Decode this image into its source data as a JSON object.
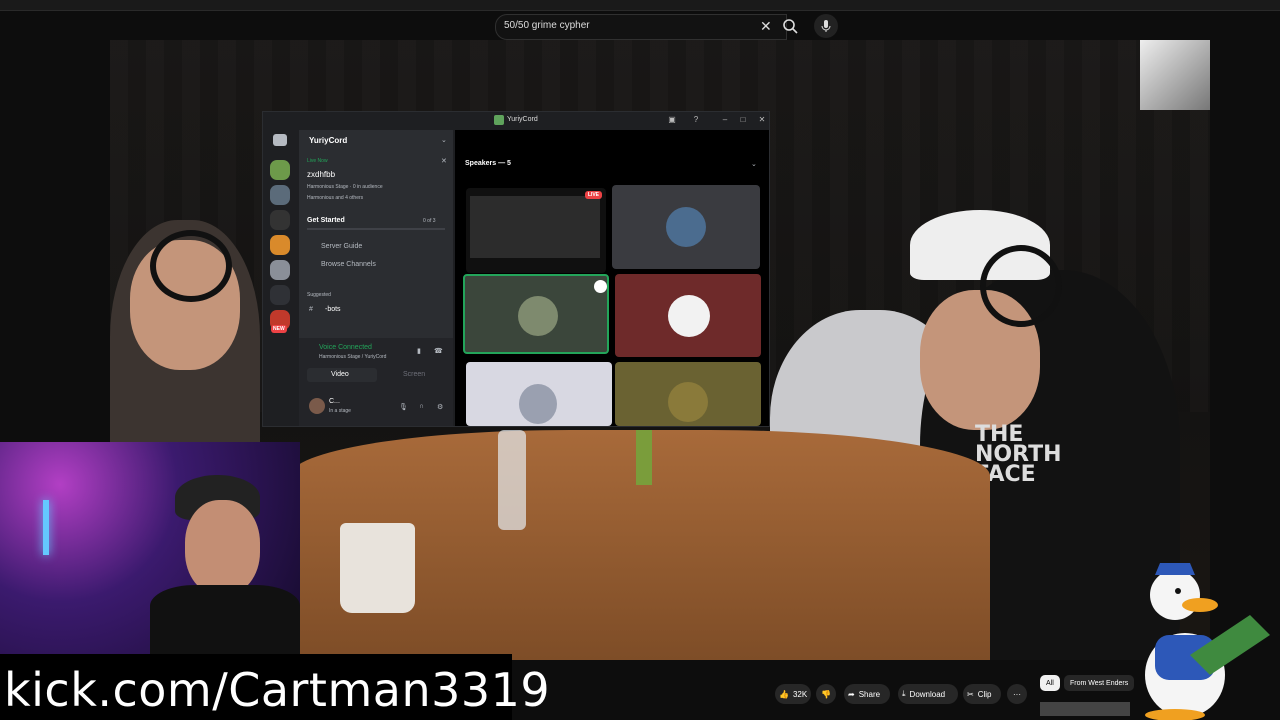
{
  "search": {
    "value": "50/50 grime cypher"
  },
  "discord": {
    "window_title": "YuriyCord",
    "server_name": "YuriyCord",
    "live_now": "Live Now",
    "stage_name": "zxdhfbb",
    "stage_sub": "Harmonious Stage · 0 in audience",
    "stage_people": "Harmonious and 4 others",
    "get_started": "Get Started",
    "get_started_progress": "0 of 3",
    "channels": [
      "Server Guide",
      "Browse Channels"
    ],
    "suggested": "Suggested",
    "bots_channel": "-bots",
    "new_badge": "NEW",
    "voice_connected": "Voice Connected",
    "voice_location": "Harmonious Stage / YuriyCord",
    "video_button": "Video",
    "screen_button": "Screen",
    "user_name": "C...",
    "user_status": "In a stage",
    "speakers_header": "Speakers — 5",
    "live_badge": "LIVE"
  },
  "overlay": {
    "kick_url": "kick.com/Cartman3319"
  },
  "actions": {
    "like_count": "32K",
    "share": "Share",
    "download": "Download",
    "clip": "Clip",
    "more": "···"
  },
  "chips": {
    "all": "All",
    "from_channel": "From West Enders"
  },
  "colors": {
    "discord_green": "#23a55a",
    "live_red": "#ed4245",
    "discord_bg": "#1e1f22"
  }
}
